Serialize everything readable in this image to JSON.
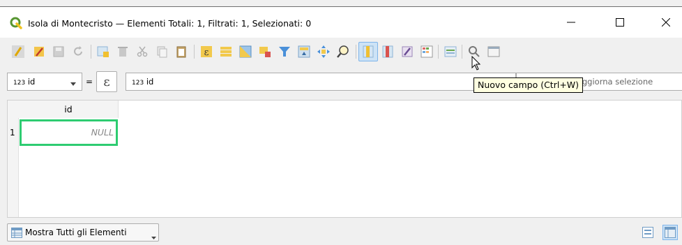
{
  "window": {
    "title": "Isola di Montecristo — Elementi Totali: 1,  Filtrati: 1, Selezionati: 0",
    "app_icon": "qgis-logo-icon",
    "controls": [
      "minimize-icon",
      "maximize-icon",
      "close-icon"
    ]
  },
  "toolbar": {
    "icons": [
      "toggle-editing-icon",
      "multi-edit-icon",
      "save-edits-icon",
      "reload-icon",
      "add-feature-icon",
      "delete-features-icon",
      "cut-icon",
      "copy-icon",
      "paste-icon",
      "expression-select-icon",
      "select-all-icon",
      "invert-selection-icon",
      "deselect-all-icon",
      "filter-selection-icon",
      "move-selection-top-icon",
      "pan-to-selection-icon",
      "zoom-to-selection-icon",
      "new-field-icon",
      "delete-field-icon",
      "field-calculator-icon",
      "conditional-formatting-icon",
      "dock-table-icon",
      "actions-icon",
      "dock-icon"
    ],
    "tooltip": "Nuovo campo (Ctrl+W)"
  },
  "filter": {
    "field_type": "123",
    "field_name": "id",
    "operator": "=",
    "epsilon_label": "ε",
    "expression_type": "123",
    "expression_value": "id",
    "update_selection_label": "Aggiorna selezione"
  },
  "table": {
    "columns": [
      "id"
    ],
    "rows": [
      {
        "row_number": "1",
        "cells": [
          "NULL"
        ]
      }
    ],
    "active_cell_color": "#2ecc71"
  },
  "bottom": {
    "show_all_label": "Mostra Tutti gli Elementi",
    "view_modes": [
      "form-view-icon",
      "table-view-icon"
    ]
  }
}
